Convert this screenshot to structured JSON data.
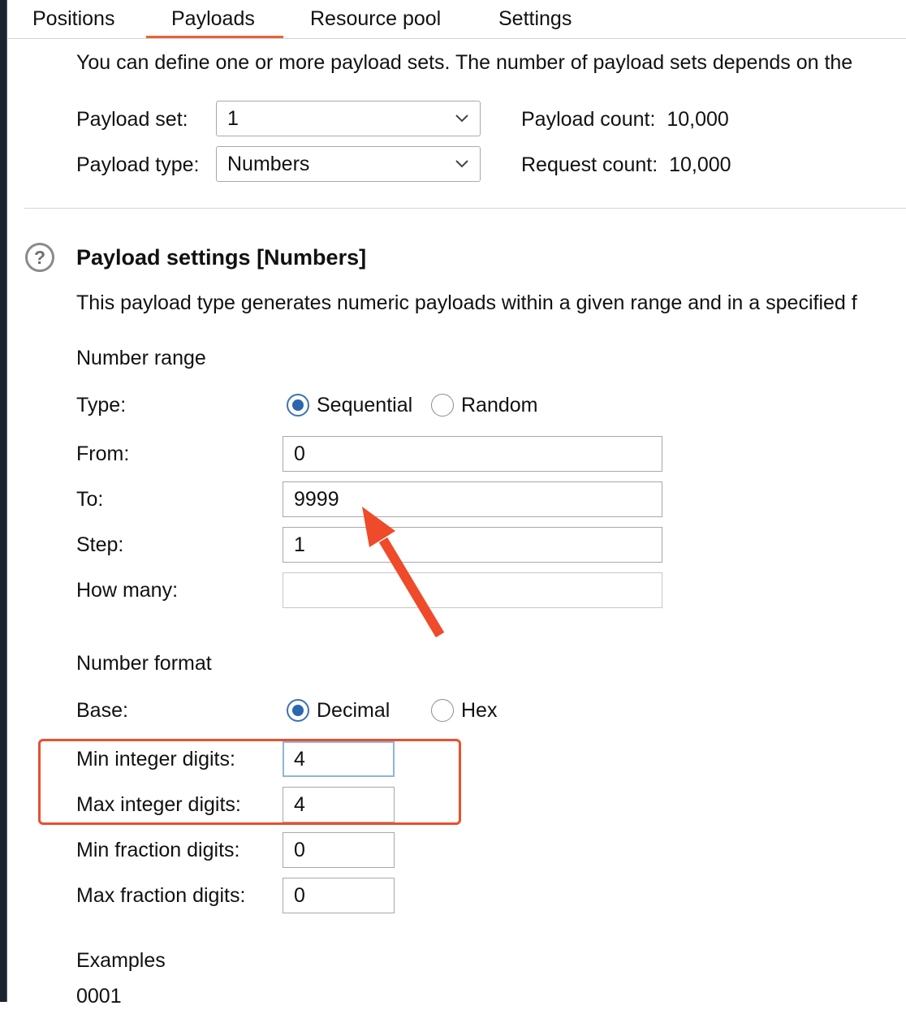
{
  "tabs": [
    "Positions",
    "Payloads",
    "Resource pool",
    "Settings"
  ],
  "active_tab": "Payloads",
  "intro_text": "You can define one or more payload sets. The number of payload sets depends on the",
  "payload_set": {
    "label": "Payload set:",
    "value": "1"
  },
  "payload_type": {
    "label": "Payload type:",
    "value": "Numbers"
  },
  "payload_count": {
    "label": "Payload count:",
    "value": "10,000"
  },
  "request_count": {
    "label": "Request count:",
    "value": "10,000"
  },
  "settings": {
    "help_glyph": "?",
    "title": "Payload settings [Numbers]",
    "description": "This payload type generates numeric payloads within a given range and in a specified f"
  },
  "number_range": {
    "section_label": "Number range",
    "type_label": "Type:",
    "type_options": [
      {
        "label": "Sequential",
        "checked": true
      },
      {
        "label": "Random",
        "checked": false
      }
    ],
    "from": {
      "label": "From:",
      "value": "0"
    },
    "to": {
      "label": "To:",
      "value": "9999"
    },
    "step": {
      "label": "Step:",
      "value": "1"
    },
    "how_many": {
      "label": "How many:",
      "value": ""
    }
  },
  "number_format": {
    "section_label": "Number format",
    "base_label": "Base:",
    "base_options": [
      {
        "label": "Decimal",
        "checked": true
      },
      {
        "label": "Hex",
        "checked": false
      }
    ],
    "min_integer_digits": {
      "label": "Min integer digits:",
      "value": "4"
    },
    "max_integer_digits": {
      "label": "Max integer digits:",
      "value": "4"
    },
    "min_fraction_digits": {
      "label": "Min fraction digits:",
      "value": "0"
    },
    "max_fraction_digits": {
      "label": "Max fraction digits:",
      "value": "0"
    }
  },
  "examples": {
    "label": "Examples",
    "first": "0001"
  },
  "annotation_colors": {
    "arrow": "#ef4a2a",
    "highlight_box": "#e8502f"
  }
}
